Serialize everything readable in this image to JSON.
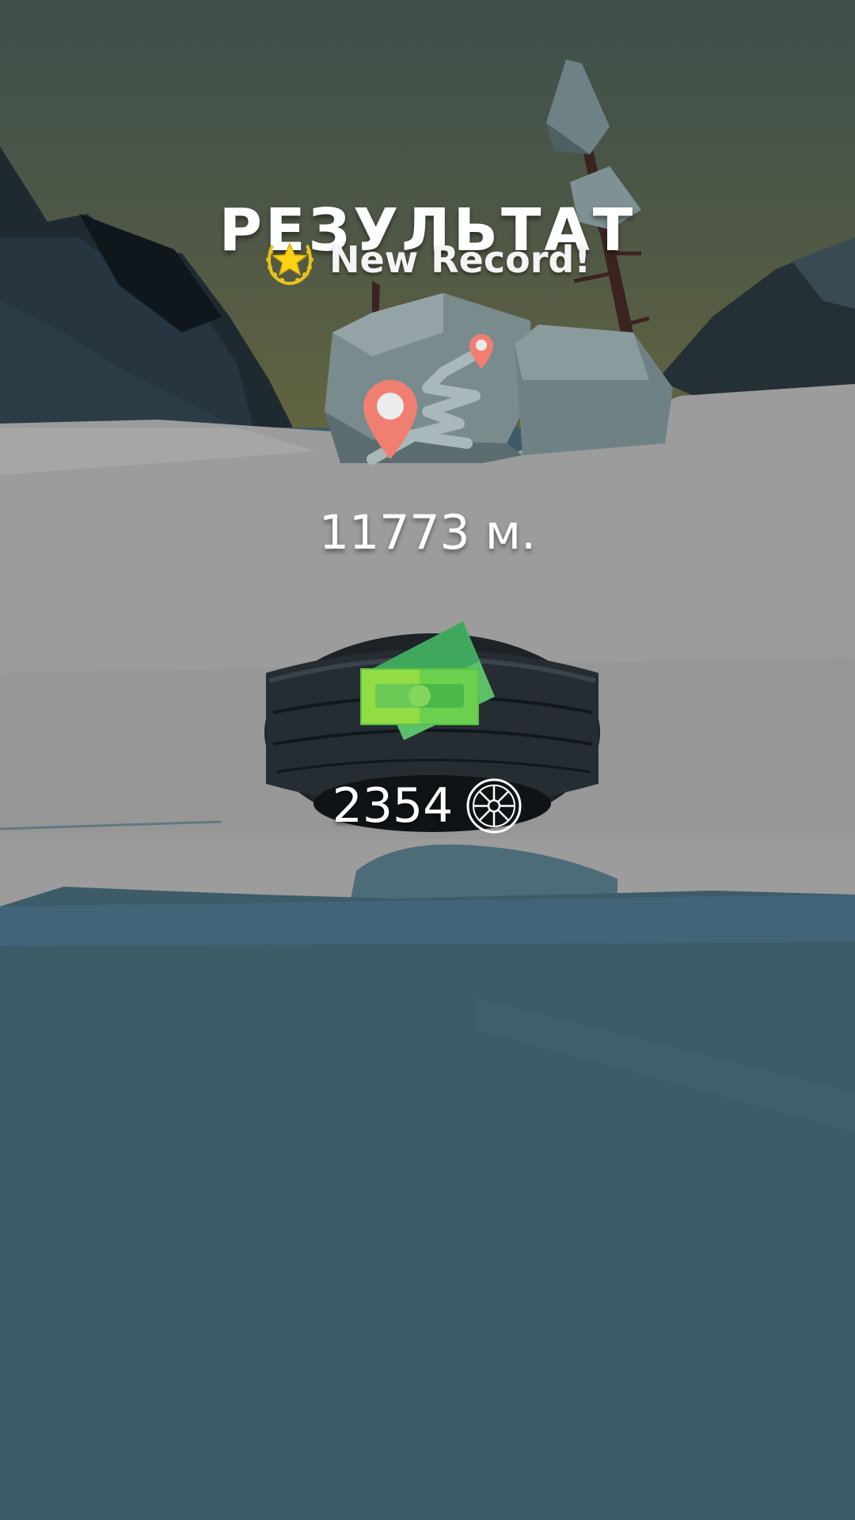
{
  "results": {
    "title": "РЕЗУЛЬТАТ",
    "new_record_label": "New Record!",
    "distance_value": "11773",
    "distance_unit": "м.",
    "coins_value": "2354"
  },
  "icons": {
    "record_badge": "laurel-star-icon",
    "map": "map-route-icon",
    "cash": "cash-icon",
    "tire": "tire-icon",
    "coin": "wheel-coin-icon"
  },
  "colors": {
    "pin": "#f07f72",
    "star": "#ffd21a",
    "cash_green": "#5fd24a",
    "water": "#3d5c68",
    "snow": "#9c9c9c"
  }
}
